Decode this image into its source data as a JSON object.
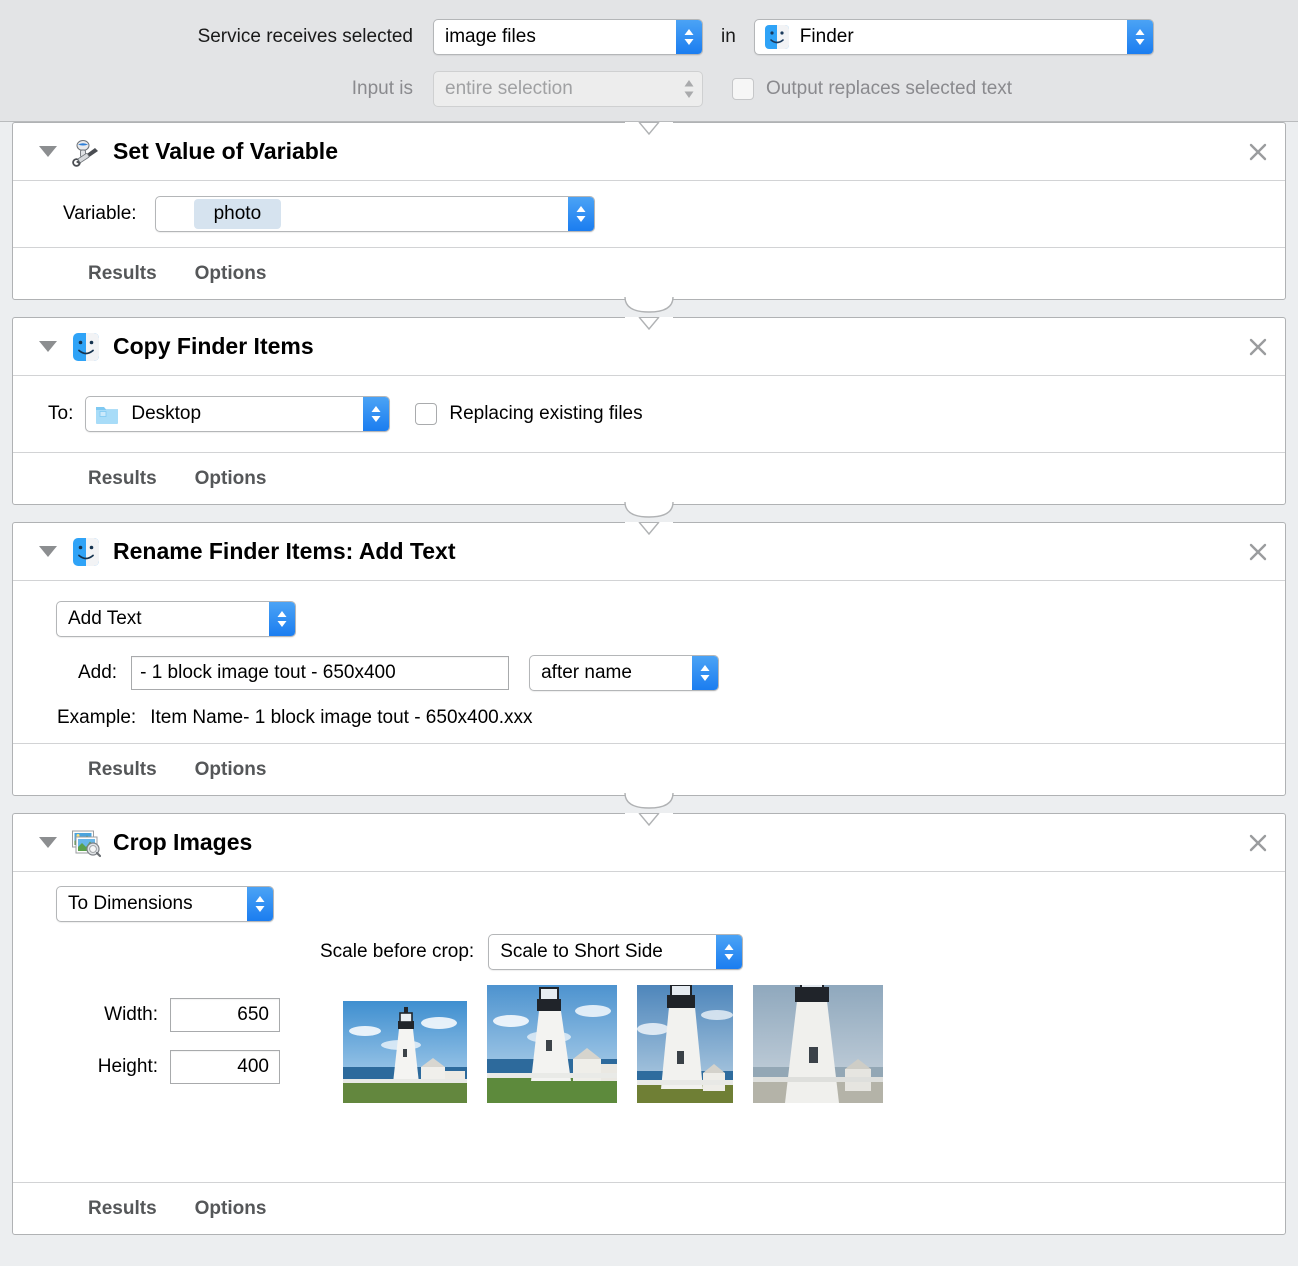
{
  "header": {
    "receives_label": "Service receives selected",
    "receives_value": "image files",
    "in_label": "in",
    "app_value": "Finder",
    "app_icon": "finder-icon",
    "input_label": "Input is",
    "input_value": "entire selection",
    "output_checkbox_label": "Output replaces selected text",
    "output_checked": false
  },
  "actions": [
    {
      "title": "Set Value of Variable",
      "icon": "automator-robot-icon",
      "close_label": "×",
      "variable_label": "Variable:",
      "variable_value": "photo",
      "footer": {
        "results": "Results",
        "options": "Options"
      }
    },
    {
      "title": "Copy Finder Items",
      "icon": "finder-icon",
      "close_label": "×",
      "to_label": "To:",
      "to_value": "Desktop",
      "to_icon": "folder-icon",
      "replacing_label": "Replacing existing files",
      "replacing_checked": false,
      "footer": {
        "results": "Results",
        "options": "Options"
      }
    },
    {
      "title": "Rename Finder Items: Add Text",
      "icon": "finder-icon",
      "close_label": "×",
      "mode_value": "Add Text",
      "add_label": "Add:",
      "add_value": "- 1 block image tout - 650x400",
      "position_value": "after name",
      "example_label": "Example:",
      "example_value": "Item Name- 1 block image tout - 650x400.xxx",
      "footer": {
        "results": "Results",
        "options": "Options"
      }
    },
    {
      "title": "Crop Images",
      "icon": "crop-images-icon",
      "close_label": "×",
      "mode_value": "To Dimensions",
      "scale_label": "Scale before crop:",
      "scale_value": "Scale to Short Side",
      "width_label": "Width:",
      "width_value": "650",
      "height_label": "Height:",
      "height_value": "400",
      "previews": [
        {
          "name": "lighthouse-preview-1"
        },
        {
          "name": "lighthouse-preview-2"
        },
        {
          "name": "lighthouse-preview-3"
        },
        {
          "name": "lighthouse-preview-4"
        }
      ],
      "footer": {
        "results": "Results",
        "options": "Options"
      }
    }
  ],
  "colors": {
    "accent": "#1b7df0",
    "window_bg": "#eceef0",
    "header_bg": "#e3e4e6",
    "token_bg": "#d6e3ef"
  }
}
